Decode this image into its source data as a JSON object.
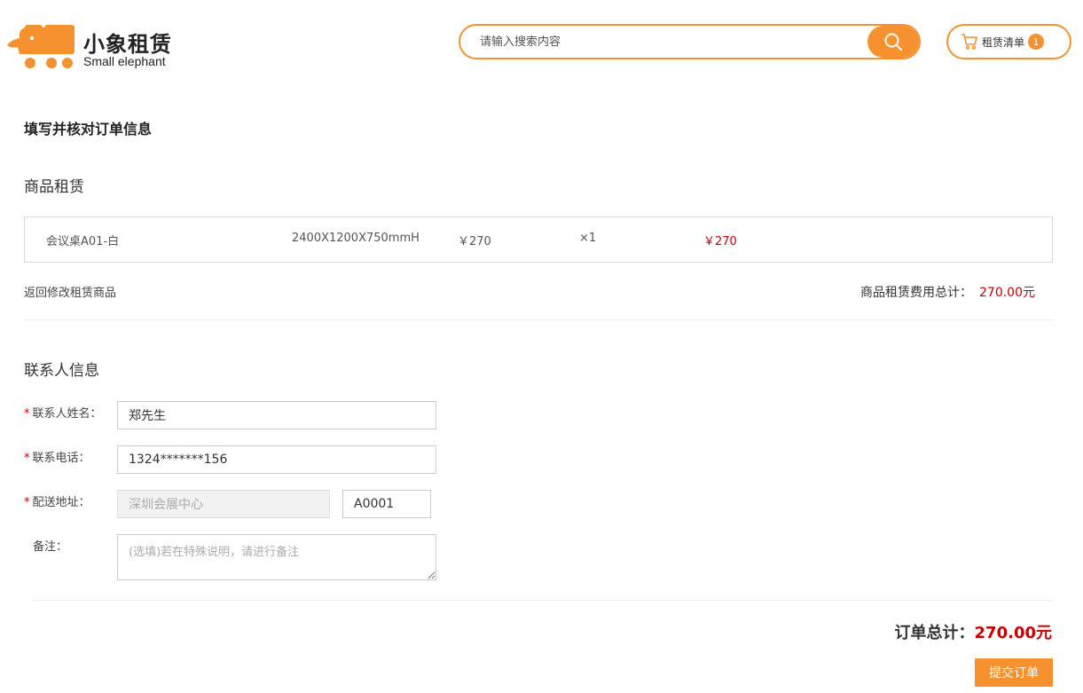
{
  "brand": {
    "name_cn": "小象租赁",
    "name_en": "Small elephant",
    "color": "#f5922f"
  },
  "search": {
    "placeholder": "请输入搜索内容",
    "value": "",
    "icon": "search-icon"
  },
  "cart": {
    "label": "租赁清单",
    "count": "1",
    "icon": "cart-icon"
  },
  "page_title": "填写并核对订单信息",
  "products_section": {
    "title": "商品租赁",
    "items": [
      {
        "name": "会议桌A01-白",
        "spec": "2400X1200X750mmH",
        "unit_price": "￥270",
        "quantity": "×1",
        "subtotal": "￥270"
      }
    ],
    "back_link": "返回修改租赁商品",
    "total_label": "商品租赁费用总计：",
    "total_value": "270.00元"
  },
  "contact_section": {
    "title": "联系人信息",
    "name_label": "联系人姓名：",
    "name_value": "郑先生",
    "phone_label": "联系电话：",
    "phone_value": "1324*******156",
    "address_label": "配送地址：",
    "address_value": "深圳会展中心",
    "booth_value": "A0001",
    "remark_label": "备注：",
    "remark_placeholder": "(选填)若在特殊说明，请进行备注",
    "required_mark": "*"
  },
  "order": {
    "total_label": "订单总计：",
    "total_value": "270.00元",
    "submit_label": "提交订单"
  }
}
